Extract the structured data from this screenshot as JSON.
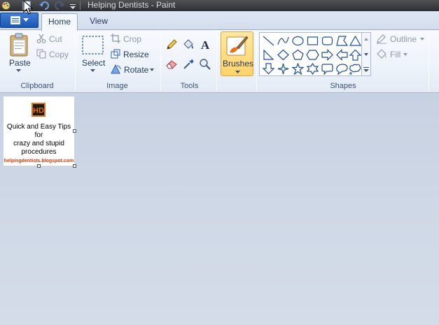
{
  "window": {
    "title": "Helping Dentists - Paint"
  },
  "tabs": [
    {
      "label": "Home",
      "active": true
    },
    {
      "label": "View",
      "active": false
    }
  ],
  "groups": {
    "clipboard": {
      "label": "Clipboard",
      "paste": "Paste",
      "cut": "Cut",
      "copy": "Copy"
    },
    "image": {
      "label": "Image",
      "select": "Select",
      "crop": "Crop",
      "resize": "Resize",
      "rotate": "Rotate"
    },
    "tools": {
      "label": "Tools"
    },
    "brushes": {
      "label": "Brushes"
    },
    "shapes": {
      "label": "Shapes",
      "outline": "Outline",
      "fill": "Fill"
    }
  },
  "canvas": {
    "tips_lines": [
      "Quick and Easy Tips",
      "for",
      "crazy and stupid",
      "procedures"
    ],
    "url": "helpingdentists.blogspot.com",
    "logo_text": "HD"
  },
  "colors": {
    "accent_blue": "#1b56b3",
    "brushes_highlight": "#ffd36a",
    "url_orange": "#d23c0a",
    "canvas_bg": "#c9d3e2"
  },
  "icons": {
    "qat": [
      "paint-icon",
      "save-icon",
      "undo-icon",
      "redo-icon",
      "customize-dropdown-icon"
    ],
    "tools": [
      "pencil-icon",
      "fill-bucket-icon",
      "text-icon",
      "eraser-icon",
      "color-picker-icon",
      "magnifier-icon"
    ]
  }
}
